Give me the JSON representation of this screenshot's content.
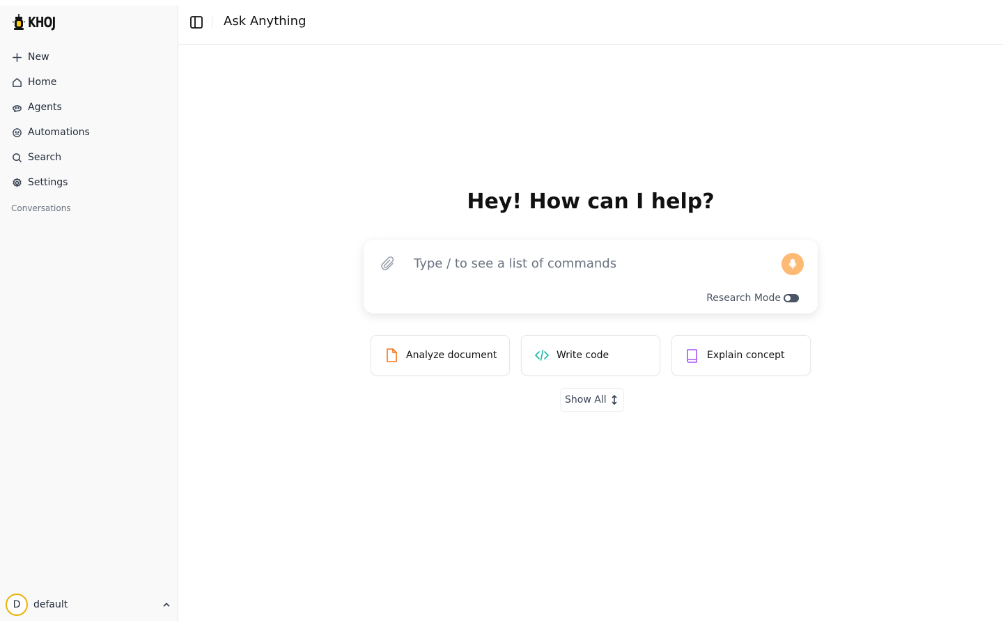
{
  "app": {
    "logo_text": "KHOJ"
  },
  "sidebar": {
    "items": [
      {
        "label": "New",
        "icon": "plus-icon"
      },
      {
        "label": "Home",
        "icon": "home-icon"
      },
      {
        "label": "Agents",
        "icon": "agent-icon"
      },
      {
        "label": "Automations",
        "icon": "automation-icon"
      },
      {
        "label": "Search",
        "icon": "search-icon"
      },
      {
        "label": "Settings",
        "icon": "gear-icon"
      }
    ],
    "section_label": "Conversations",
    "user": {
      "initial": "D",
      "name": "default"
    }
  },
  "header": {
    "title": "Ask Anything"
  },
  "main": {
    "greeting": "Hey! How can I help?",
    "chat": {
      "placeholder": "Type / to see a list of commands",
      "research_label": "Research Mode",
      "research_enabled": false
    },
    "suggestions": [
      {
        "label": "Analyze document",
        "icon": "document-icon",
        "color": "#f97316"
      },
      {
        "label": "Write code",
        "icon": "code-icon",
        "color": "#14b8a6"
      },
      {
        "label": "Explain concept",
        "icon": "book-icon",
        "color": "#a855f7"
      }
    ],
    "show_all_label": "Show All"
  },
  "colors": {
    "accent": "#fdba74",
    "avatar_ring": "#eab308"
  }
}
